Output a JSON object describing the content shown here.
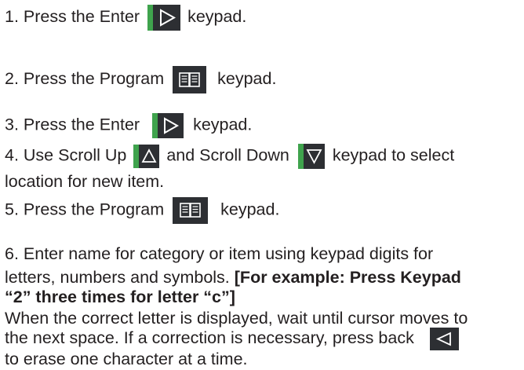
{
  "steps": {
    "s1": {
      "text_a": "1.  Press the Enter",
      "text_b": "keypad."
    },
    "s2": {
      "text_a": "2.  Press the Program",
      "text_b": "keypad."
    },
    "s3": {
      "text_a": "3.  Press the Enter",
      "text_b": "keypad."
    },
    "s4": {
      "text_a": "4. Use Scroll Up",
      "text_b": "and Scroll Down",
      "text_c": "keypad to select",
      "line2": "location for new item."
    },
    "s5": {
      "text_a": "5. Press the Program",
      "text_b": "keypad."
    },
    "s6": {
      "line1": "6.  Enter name for category or item using keypad digits for",
      "line2_a": "letters, numbers and symbols.",
      "line2_b": " [For example:  Press Keypad",
      "line3": "“2”  three times for letter “c”]",
      "line4": "When the correct letter is displayed, wait until cursor moves to",
      "line5_a": "the next space. If a correction is necessary, press back",
      "line6": "to erase one character at a time."
    }
  },
  "icons": {
    "enter": "enter-keypad-icon",
    "program": "program-book-icon",
    "scroll_up": "scroll-up-icon",
    "scroll_down": "scroll-down-icon",
    "back": "back-arrow-icon"
  },
  "colors": {
    "text": "#231f20",
    "keypad": "#2d2f33",
    "accent_green": "#3fa34d",
    "icon_stroke": "#ffffff"
  }
}
